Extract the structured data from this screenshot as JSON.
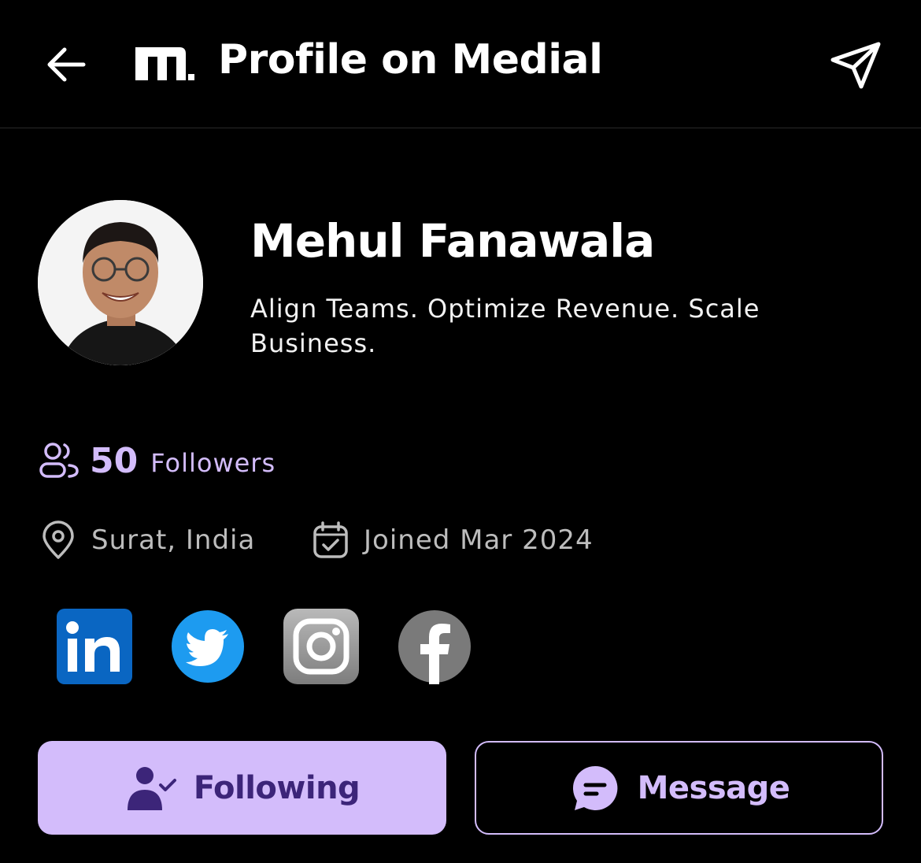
{
  "header": {
    "title": "Profile on Medial",
    "back_icon": "arrow-left-icon",
    "share_icon": "send-icon",
    "logo_icon": "medial-logo"
  },
  "profile": {
    "name": "Mehul Fanawala",
    "bio": "Align Teams. Optimize Revenue. Scale Business.",
    "followers_count": "50",
    "followers_label": "Followers",
    "location": "Surat, India",
    "joined": "Joined Mar 2024"
  },
  "socials": [
    {
      "name": "linkedin",
      "icon": "linkedin-icon",
      "color": "#0a66c2"
    },
    {
      "name": "twitter",
      "icon": "twitter-icon",
      "color": "#1d9bf0"
    },
    {
      "name": "instagram",
      "icon": "instagram-icon",
      "color": "#9a9a9a"
    },
    {
      "name": "facebook",
      "icon": "facebook-icon",
      "color": "#7a7a7a"
    }
  ],
  "actions": {
    "following_label": "Following",
    "message_label": "Message"
  },
  "colors": {
    "background": "#000000",
    "accent": "#d3bcfb",
    "accent_dark": "#3c2579",
    "muted_text": "#bdbdbd"
  }
}
